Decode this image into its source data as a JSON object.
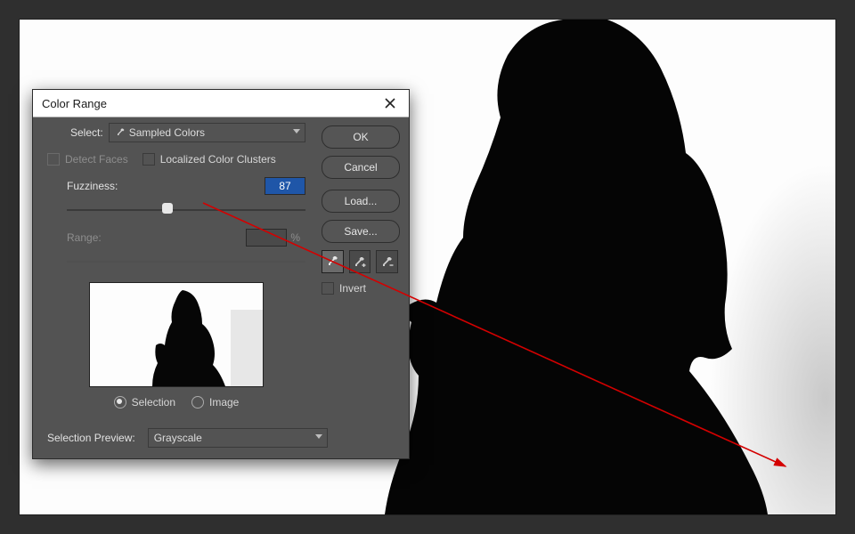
{
  "dialog": {
    "title": "Color Range",
    "select_label": "Select:",
    "select_value": "Sampled Colors",
    "detect_faces": "Detect Faces",
    "localized": "Localized Color Clusters",
    "fuzziness_label": "Fuzziness:",
    "fuzziness_value": "87",
    "range_label": "Range:",
    "range_value": "",
    "range_pct": "%",
    "radio_selection": "Selection",
    "radio_image": "Image",
    "selection_preview_label": "Selection Preview:",
    "selection_preview_value": "Grayscale",
    "invert": "Invert"
  },
  "buttons": {
    "ok": "OK",
    "cancel": "Cancel",
    "load": "Load...",
    "save": "Save..."
  },
  "slider": {
    "fuzziness_pos_pct": 42
  }
}
